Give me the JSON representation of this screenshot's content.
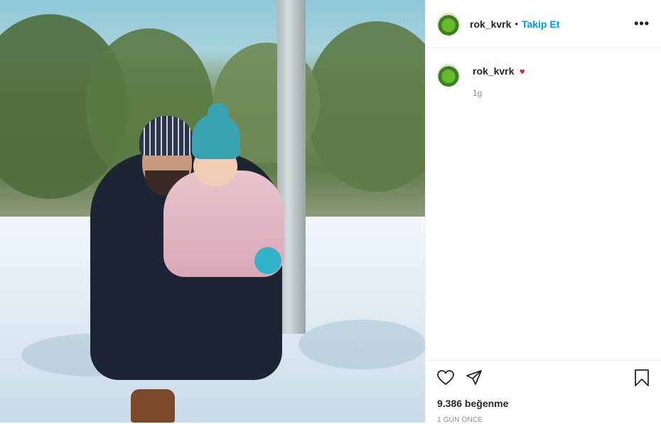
{
  "post": {
    "username": "rok_kvrk",
    "separator": "•",
    "follow_label": "Takip Et",
    "more_label": "•••"
  },
  "caption": {
    "username": "rok_kvrk",
    "heart": "♥",
    "time": "1g"
  },
  "stats": {
    "likes": "9.386 beğenme",
    "date": "1 GÜN ÖNCE"
  },
  "icons": {
    "like": "heart-outline-icon",
    "share": "paper-plane-icon",
    "save": "bookmark-icon"
  },
  "colors": {
    "follow": "#0095f6",
    "heart": "#d8222f",
    "muted": "#8e8e8e"
  }
}
